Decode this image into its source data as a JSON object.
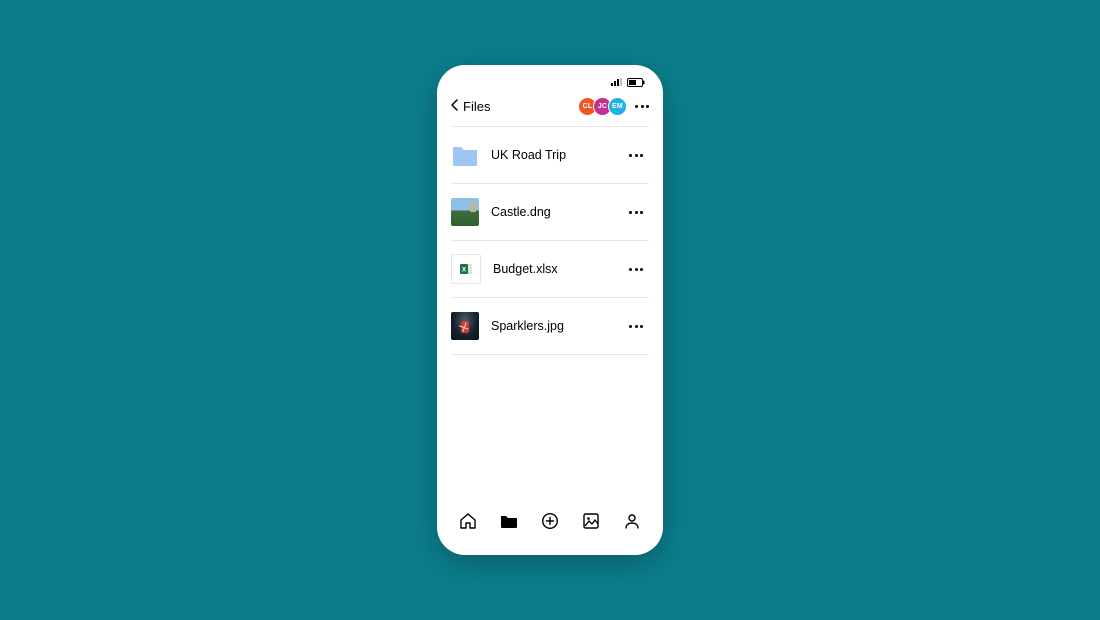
{
  "header": {
    "back_label": "Files",
    "avatars": [
      {
        "initials": "CL",
        "color": "#f05822"
      },
      {
        "initials": "JC",
        "color": "#c72e8e"
      },
      {
        "initials": "EM",
        "color": "#1fb2e6"
      }
    ]
  },
  "files": [
    {
      "name": "UK Road Trip",
      "type": "folder"
    },
    {
      "name": "Castle.dng",
      "type": "image-castle"
    },
    {
      "name": "Budget.xlsx",
      "type": "xlsx"
    },
    {
      "name": "Sparklers.jpg",
      "type": "image-sparklers"
    }
  ],
  "tabs": {
    "home": "home-icon",
    "files": "folder-icon",
    "add": "plus-circle-icon",
    "photos": "photo-icon",
    "account": "person-icon"
  }
}
